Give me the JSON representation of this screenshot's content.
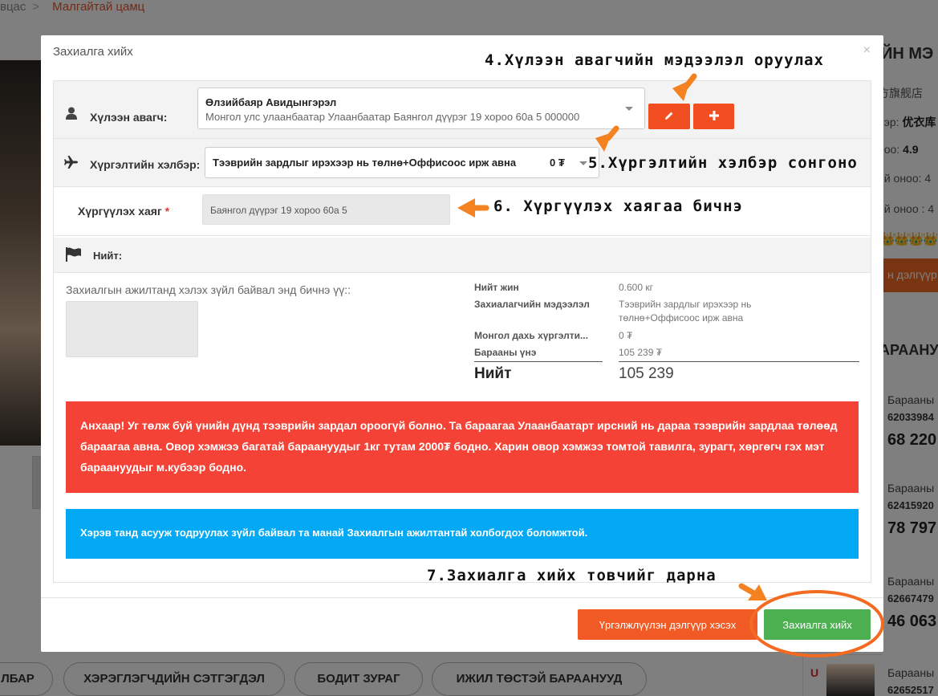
{
  "background": {
    "breadcrumb": {
      "prev": "вцас",
      "current": "Малгайтай цамц",
      "sep": ">"
    },
    "right_panel": {
      "title": "ЙН МЭ",
      "store": "方旗舰店",
      "seller_line": "нэр: ",
      "seller_name": "优衣库",
      "rating_label": "ноо: ",
      "rating": "4.9",
      "score1": "ий оноо: 4",
      "score2": "ий оноо : 4",
      "crowns": "👑👑👑👑",
      "visit_button": "н дэлгүүр",
      "section_title": "АРААНУ",
      "products": [
        {
          "name": "Барааны",
          "code": "62033984",
          "price": "68 220"
        },
        {
          "name": "Барааны",
          "code": "62415920",
          "price": "78 797"
        },
        {
          "name": "Барааны",
          "code": "62667479",
          "price": "46 063"
        },
        {
          "name": "Барааны",
          "code": "62652517"
        }
      ],
      "u_logo": "U"
    },
    "tabs": [
      "ЛБАР",
      "ХЭРЭГЛЭГЧДИЙН СЭТГЭГДЭЛ",
      "БОДИТ ЗУРАГ",
      "ИЖИЛ ТӨСТЭЙ БАРААНУУД"
    ]
  },
  "modal": {
    "title": "Захиалга хийх",
    "close": "×",
    "customer": {
      "label": "Хүлээн авагч:",
      "name": "Өлзийбаяр Авидынгэрэл",
      "address": "Монгол улс улаанбаатар Улаанбаатар Баянгол дүүрэг 19 хороо 60а 5 000000",
      "edit_icon": "pencil-icon",
      "add_icon": "plus-icon"
    },
    "delivery": {
      "label": "Хүргэлтийн хэлбэр:",
      "value": "Тээврийн зардлыг ирэхээр нь төлнө+Оффисоос ирж авна",
      "price": "0 ₮"
    },
    "address": {
      "label": "Хүргүүлэх хаяг",
      "required": "*",
      "value": "Баянгол дүүрэг 19 хороо 60а 5"
    },
    "total_header": "Нийт:",
    "note_label": "Захиалгын ажилтанд хэлэх зүйл байвал энд бичнэ үү::",
    "summary": {
      "weight_label": "Нийт жин",
      "weight": "0.600 кг",
      "buyer_label": "Захиалагчийн мэдээлэл",
      "buyer_line1": "Тээврийн зардлыг ирэхээр нь",
      "buyer_line2": "төлнө+Оффисоос ирж авна",
      "shipping_label": "Монгол дахь хүргэлти...",
      "shipping": "0 ₮",
      "price_label": "Барааны үнэ",
      "price": "105 239 ₮",
      "total_label": "Нийт",
      "total": "105 239"
    },
    "alert_warning": "Анхаар! Уг төлж буй үнийн дүнд тээврийн зардал ороогүй болно. Та бараагаа Улаанбаатарт ирсний нь дараа тээврийн зардлаа төлөөд бараагаа авна. Овор хэмжээ багатай бараануудыг 1кг тутам 2000₮ бодно. Харин овор хэмжээ томтой тавилга, зурагт, хөргөгч гэх мэт бараануудыг м.кубээр бодно.",
    "alert_info": "Хэрэв танд асууж тодруулах зүйл байвал та манай Захиалгын ажилтантай холбогдох боломжтой.",
    "continue_button": "Үргэлжлүүлэн дэлгүүр хэсэх",
    "order_button": "Захиалга хийх"
  },
  "annotations": {
    "step4": "4.Хүлээн авагчийн мэдээлэл оруулах",
    "step5": "5.Хүргэлтийн хэлбэр сонгоно",
    "step6": "6. Хүргүүлэх хаягаа бичнэ",
    "step7": "7.Захиалга хийх товчийг дарна",
    "arrow_color": "#f58220",
    "circle_color": "#f26b21"
  }
}
